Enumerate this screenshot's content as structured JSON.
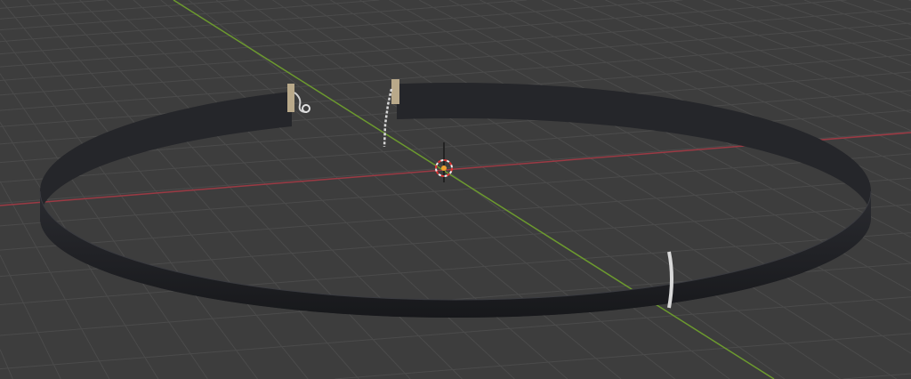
{
  "viewport": {
    "mode": "3D viewport",
    "colors": {
      "background": "#3d3d3d",
      "grid": "#4a4a4a",
      "x_axis": "#9b3a44",
      "y_axis": "#6c9a2e",
      "band": "#1e1f23",
      "metal": "#c8c8c8",
      "cursor": "#c83232"
    },
    "scene_object": "choker-necklace"
  }
}
